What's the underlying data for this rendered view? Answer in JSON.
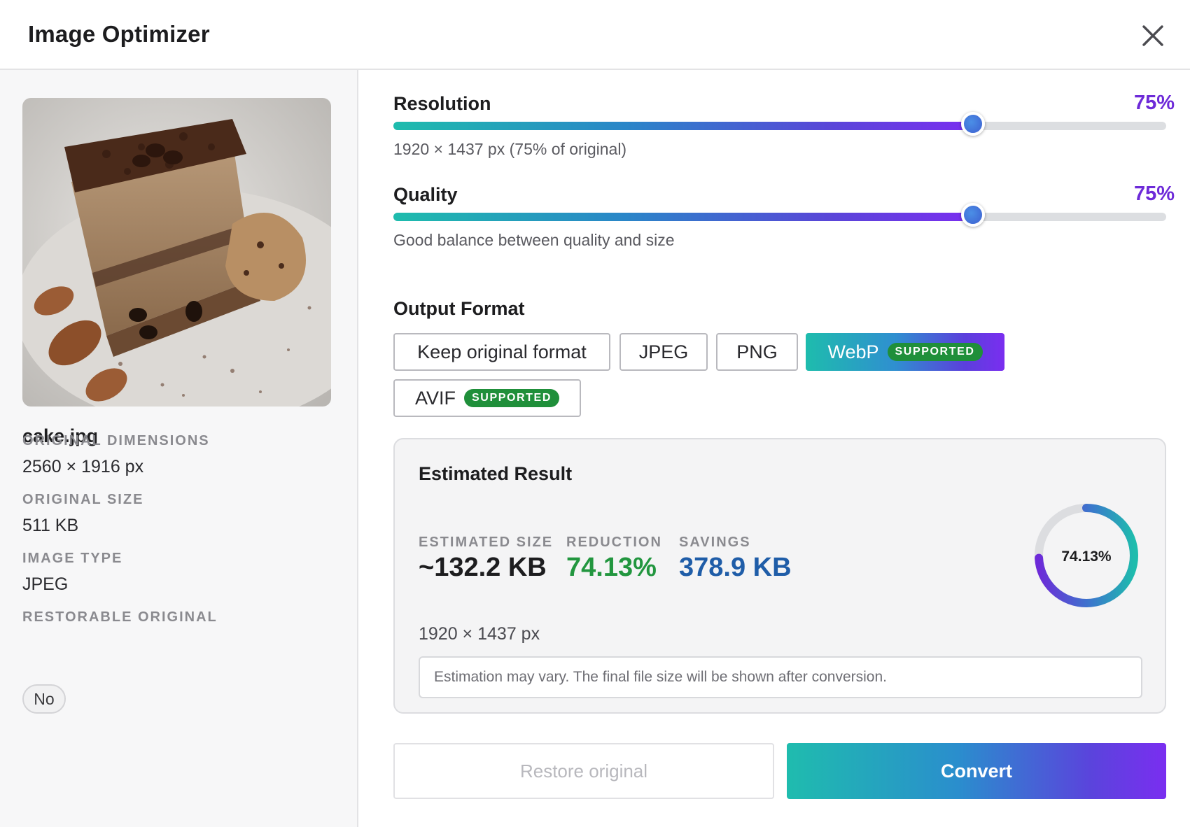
{
  "window": {
    "title": "Image Optimizer"
  },
  "icons": {
    "close": "close-icon"
  },
  "sidebar": {
    "filename": "cake.jpg",
    "original_dimensions": {
      "label": "ORIGINAL DIMENSIONS",
      "value": "2560 × 1916 px"
    },
    "original_size": {
      "label": "ORIGINAL SIZE",
      "value": "511 KB"
    },
    "image_type": {
      "label": "IMAGE TYPE",
      "value": "JPEG"
    },
    "restorable_original": {
      "label": "RESTORABLE ORIGINAL",
      "value": "No"
    }
  },
  "resolution": {
    "label": "Resolution",
    "value_text": "75%",
    "percent": 75,
    "help": "1920 × 1437 px (75% of original)"
  },
  "quality": {
    "label": "Quality",
    "value_text": "75%",
    "percent": 75,
    "help": "Good balance between quality and size"
  },
  "output_format": {
    "title": "Output Format",
    "options": [
      {
        "label": "Keep original format",
        "badge": "",
        "selected": false
      },
      {
        "label": "JPEG",
        "badge": "",
        "selected": false
      },
      {
        "label": "PNG",
        "badge": "",
        "selected": false
      },
      {
        "label": "WebP",
        "badge": "SUPPORTED",
        "selected": true
      },
      {
        "label": "AVIF",
        "badge": "SUPPORTED",
        "selected": false
      }
    ]
  },
  "estimate": {
    "title": "Estimated Result",
    "size": {
      "label": "ESTIMATED SIZE",
      "value": "~132.2 KB"
    },
    "reduction": {
      "label": "REDUCTION",
      "value": "74.13%"
    },
    "savings": {
      "label": "SAVINGS",
      "value": "378.9 KB"
    },
    "ring_text": "74.13%",
    "ring_percent": 74.13,
    "dimensions": "1920 × 1437 px",
    "note": "Estimation may vary. The final file size will be shown after conversion."
  },
  "actions": {
    "restore": "Restore original",
    "convert": "Convert"
  },
  "colors": {
    "accent": "#6d2ad8",
    "gradient_start": "#1ebcad",
    "gradient_end": "#7a2ef0",
    "reduction": "#22963f",
    "savings": "#1f5da8",
    "supported_badge": "#1f8f3a"
  }
}
